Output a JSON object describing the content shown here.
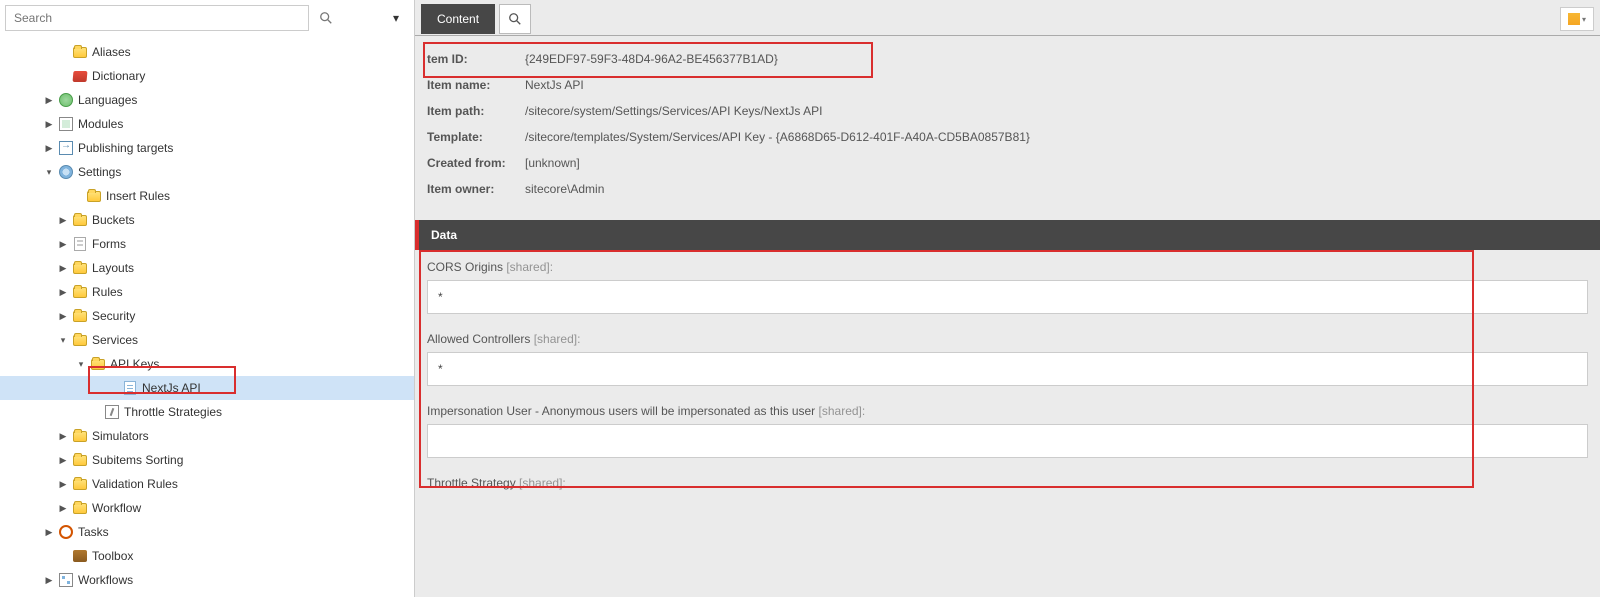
{
  "search": {
    "placeholder": "Search"
  },
  "tree": {
    "aliases": "Aliases",
    "dictionary": "Dictionary",
    "languages": "Languages",
    "modules": "Modules",
    "publishing": "Publishing targets",
    "settings": "Settings",
    "insert_rules": "Insert Rules",
    "buckets": "Buckets",
    "forms": "Forms",
    "layouts": "Layouts",
    "rules": "Rules",
    "security": "Security",
    "services": "Services",
    "api_keys": "API Keys",
    "nextjs_api": "NextJs API",
    "throttle_strategies": "Throttle Strategies",
    "simulators": "Simulators",
    "subitems_sorting": "Subitems Sorting",
    "validation_rules": "Validation Rules",
    "workflow": "Workflow",
    "tasks": "Tasks",
    "toolbox": "Toolbox",
    "workflows": "Workflows"
  },
  "tabs": {
    "content": "Content"
  },
  "quickinfo": {
    "labels": {
      "item_id": "tem ID:",
      "item_name": "Item name:",
      "item_path": "Item path:",
      "template": "Template:",
      "created_from": "Created from:",
      "item_owner": "Item owner:"
    },
    "values": {
      "item_id": "{249EDF97-59F3-48D4-96A2-BE456377B1AD}",
      "item_name": "NextJs API",
      "item_path": "/sitecore/system/Settings/Services/API Keys/NextJs API",
      "template": "/sitecore/templates/System/Services/API Key - {A6868D65-D612-401F-A40A-CD5BA0857B81}",
      "created_from": "[unknown]",
      "item_owner": "sitecore\\Admin"
    }
  },
  "section": {
    "data": "Data"
  },
  "fields": {
    "cors_label": "CORS Origins",
    "cors_value": "*",
    "allowed_label": "Allowed Controllers",
    "allowed_value": "*",
    "impersonation_label": "Impersonation User - Anonymous users will be impersonated as this user",
    "impersonation_value": "",
    "throttle_label": "Throttle Strategy",
    "shared_suffix": " [shared]:"
  }
}
